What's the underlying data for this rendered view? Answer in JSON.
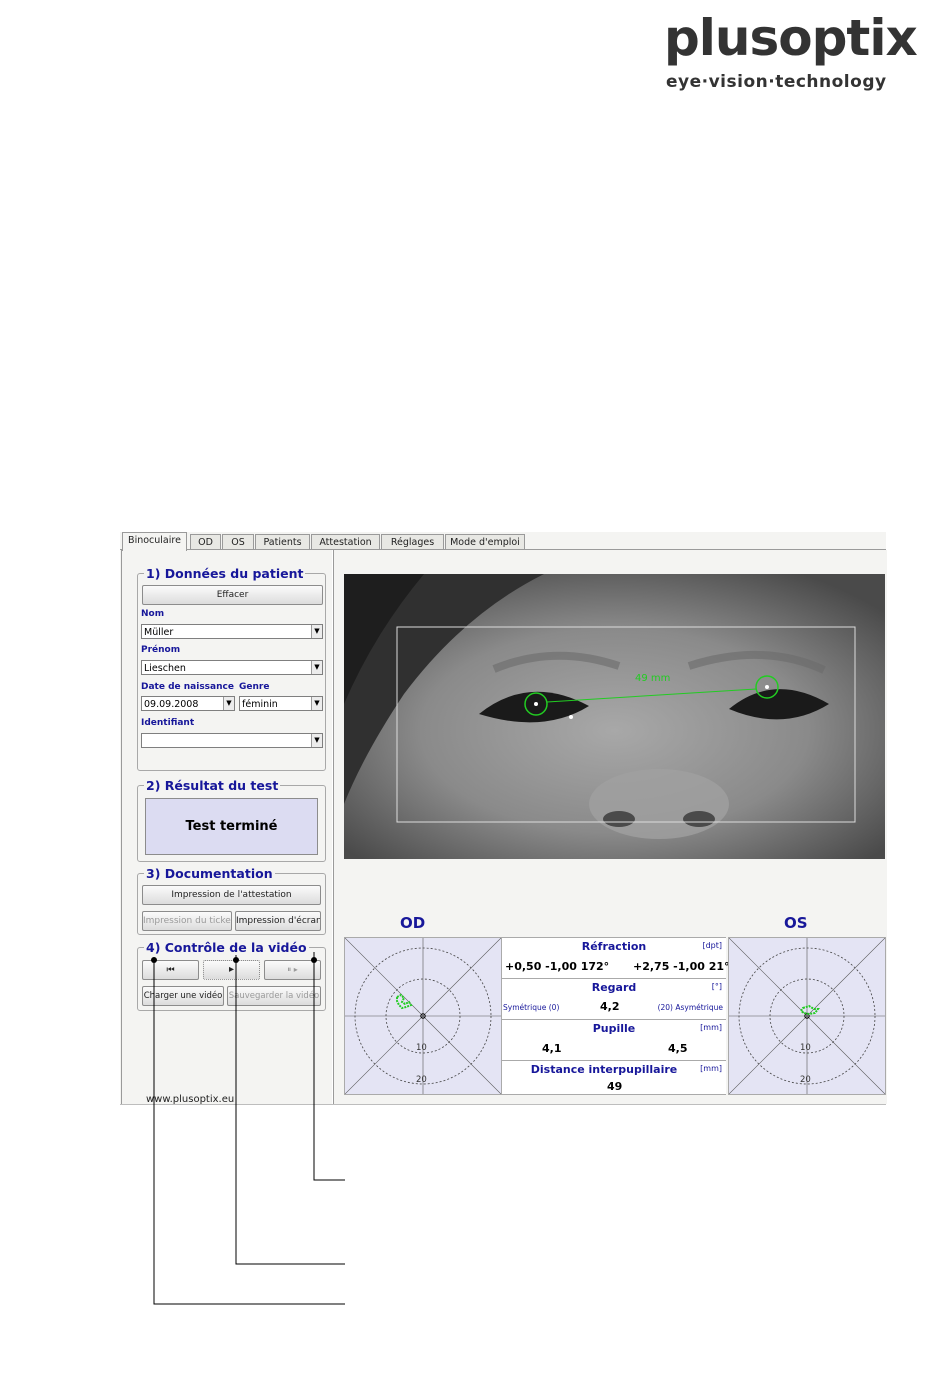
{
  "logo": {
    "name": "plusoptix",
    "tagline": "eye·vision·technology"
  },
  "tabs": [
    {
      "label": "Binoculaire"
    },
    {
      "label": "OD"
    },
    {
      "label": "OS"
    },
    {
      "label": "Patients"
    },
    {
      "label": "Attestation"
    },
    {
      "label": "Réglages"
    },
    {
      "label": "Mode d'emploi"
    }
  ],
  "patient": {
    "legend": "1) Données du patient",
    "clear_label": "Effacer",
    "nom_label": "Nom",
    "nom_value": "Müller",
    "prenom_label": "Prénom",
    "prenom_value": "Lieschen",
    "dob_label": "Date de naissance",
    "dob_value": "09.09.2008",
    "gender_label": "Genre",
    "gender_value": "féminin",
    "id_label": "Identifiant",
    "id_value": ""
  },
  "result": {
    "legend": "2) Résultat du test",
    "status": "Test terminé"
  },
  "documentation": {
    "legend": "3) Documentation",
    "attestation_label": "Impression de l'attestation",
    "ticket_label": "Impression du ticket",
    "screen_label": "Impression d'écran"
  },
  "video": {
    "legend": "4) Contrôle de la vidéo",
    "rewind_icon": "⏮",
    "play_icon": "▸",
    "pause_icon": "⏸ ▸",
    "load_label": "Charger une vidéo",
    "save_label": "Sauvegarder la vidéo"
  },
  "website": "www.plusoptix.eu",
  "photo": {
    "distance_label": "49 mm"
  },
  "od": {
    "title": "OD"
  },
  "os": {
    "title": "OS"
  },
  "chart_rings": {
    "inner": "10",
    "outer": "20"
  },
  "measurements": {
    "refraction": {
      "title": "Réfraction",
      "unit": "[dpt]",
      "od": "+0,50  -1,00 172°",
      "os": "+2,75  -1,00 21°"
    },
    "gaze": {
      "title": "Regard",
      "unit": "[°]",
      "left_label": "Symétrique (0)",
      "value": "4,2",
      "right_label": "(20) Asymétrique"
    },
    "pupil": {
      "title": "Pupille",
      "unit": "[mm]",
      "od": "4,1",
      "os": "4,5"
    },
    "ipd": {
      "title": "Distance interpupillaire",
      "unit": "[mm]",
      "value": "49"
    }
  },
  "colors": {
    "accent": "#17179a",
    "chart_bg": "#e4e4f4",
    "tracking": "#22cc22"
  }
}
